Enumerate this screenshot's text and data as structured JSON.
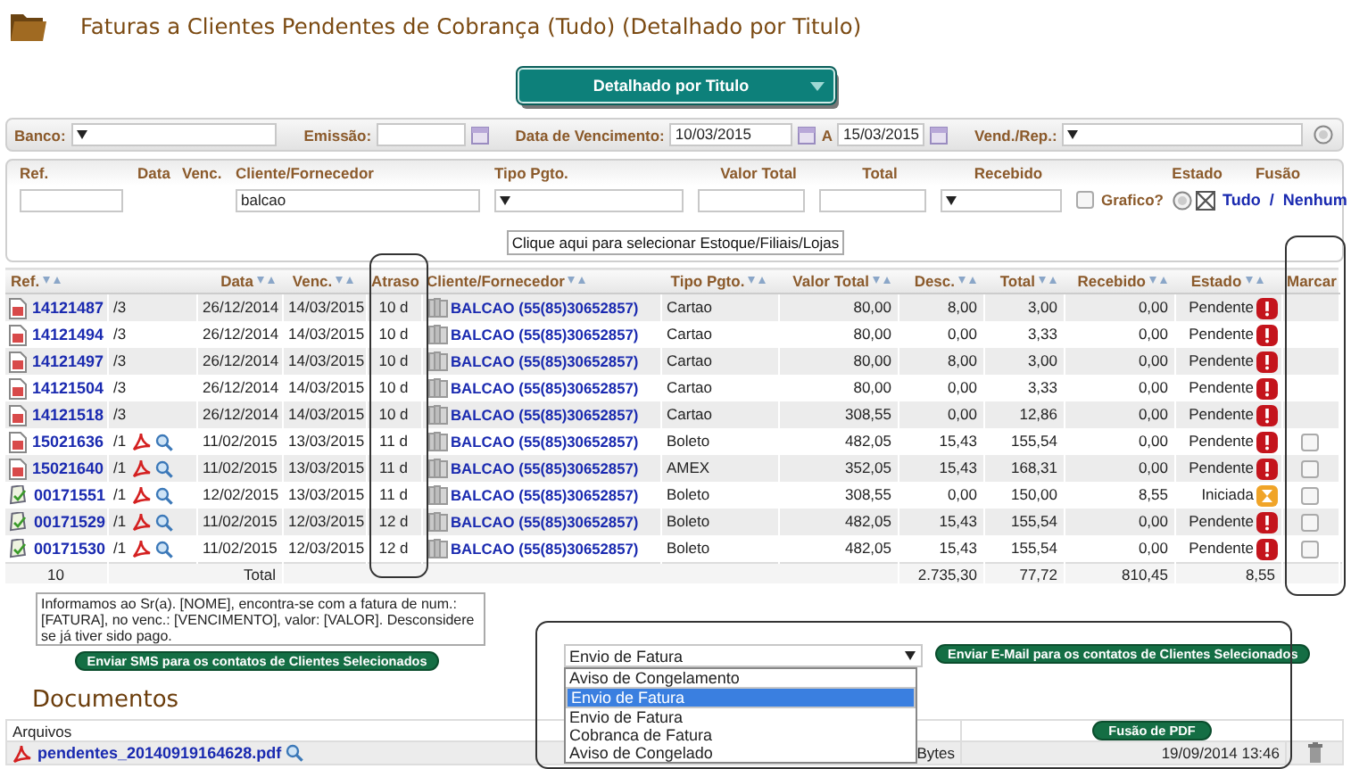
{
  "page": {
    "title": "Faturas a Clientes Pendentes de Cobrança (Tudo) (Detalhado por Titulo)"
  },
  "view_select": {
    "value": "Detalhado por Titulo"
  },
  "filters": {
    "banco_label": "Banco:",
    "emissao_label": "Emissão:",
    "vencimento_label": "Data de Vencimento:",
    "vencimento_from": "10/03/2015",
    "range_label": "A",
    "vencimento_to": "15/03/2015",
    "vendedor_label": "Vend./Rep.:"
  },
  "search": {
    "labels": [
      "Ref.",
      "Data",
      "Venc.",
      "Cliente/Fornecedor",
      "Tipo Pgto.",
      "Valor Total",
      "Total",
      "Recebido",
      "Estado",
      "Fusão"
    ],
    "cliente_value": "balcao",
    "grafico_label": "Grafico?",
    "grafico_checked": false,
    "all_link": "Tudo",
    "separator": "/",
    "none_link": "Nenhum",
    "stores_button": "Clique aqui para selecionar Estoque/Filiais/Lojas"
  },
  "table": {
    "columns": [
      {
        "label": "Ref.",
        "sortable": true
      },
      {
        "label": "Data",
        "sortable": true
      },
      {
        "label": "Venc.",
        "sortable": true
      },
      {
        "label": "Atraso",
        "sortable": false
      },
      {
        "label": "Cliente/Fornecedor",
        "sortable": true
      },
      {
        "label": "Tipo Pgto.",
        "sortable": true
      },
      {
        "label": "Valor Total",
        "sortable": true
      },
      {
        "label": "Desc.",
        "sortable": true
      },
      {
        "label": "Total",
        "sortable": true
      },
      {
        "label": "Recebido",
        "sortable": true
      },
      {
        "label": "Estado",
        "sortable": true
      },
      {
        "label": "Marcar",
        "sortable": false
      }
    ],
    "rows": [
      {
        "kind": "document",
        "ref": "14121487",
        "parcel": "/3",
        "attachments": false,
        "data": "26/12/2014",
        "venc": "14/03/2015",
        "atraso": "10 d",
        "cliente": "BALCAO (55(85)30652857)",
        "tipo": "Cartao",
        "valor_total": "80,00",
        "desc": "8,00",
        "total": "3,00",
        "recebido": "0,00",
        "estado": {
          "label": "Pendente",
          "kind": "pending"
        },
        "markable": false
      },
      {
        "kind": "document",
        "ref": "14121494",
        "parcel": "/3",
        "attachments": false,
        "data": "26/12/2014",
        "venc": "14/03/2015",
        "atraso": "10 d",
        "cliente": "BALCAO (55(85)30652857)",
        "tipo": "Cartao",
        "valor_total": "80,00",
        "desc": "0,00",
        "total": "3,33",
        "recebido": "0,00",
        "estado": {
          "label": "Pendente",
          "kind": "pending"
        },
        "markable": false
      },
      {
        "kind": "document",
        "ref": "14121497",
        "parcel": "/3",
        "attachments": false,
        "data": "26/12/2014",
        "venc": "14/03/2015",
        "atraso": "10 d",
        "cliente": "BALCAO (55(85)30652857)",
        "tipo": "Cartao",
        "valor_total": "80,00",
        "desc": "8,00",
        "total": "3,00",
        "recebido": "0,00",
        "estado": {
          "label": "Pendente",
          "kind": "pending"
        },
        "markable": false
      },
      {
        "kind": "document",
        "ref": "14121504",
        "parcel": "/3",
        "attachments": false,
        "data": "26/12/2014",
        "venc": "14/03/2015",
        "atraso": "10 d",
        "cliente": "BALCAO (55(85)30652857)",
        "tipo": "Cartao",
        "valor_total": "80,00",
        "desc": "0,00",
        "total": "3,33",
        "recebido": "0,00",
        "estado": {
          "label": "Pendente",
          "kind": "pending"
        },
        "markable": false
      },
      {
        "kind": "document",
        "ref": "14121518",
        "parcel": "/3",
        "attachments": false,
        "data": "26/12/2014",
        "venc": "14/03/2015",
        "atraso": "10 d",
        "cliente": "BALCAO (55(85)30652857)",
        "tipo": "Cartao",
        "valor_total": "308,55",
        "desc": "0,00",
        "total": "12,86",
        "recebido": "0,00",
        "estado": {
          "label": "Pendente",
          "kind": "pending"
        },
        "markable": false
      },
      {
        "kind": "document",
        "ref": "15021636",
        "parcel": "/1",
        "attachments": true,
        "data": "11/02/2015",
        "venc": "13/03/2015",
        "atraso": "11 d",
        "cliente": "BALCAO (55(85)30652857)",
        "tipo": "Boleto",
        "valor_total": "482,05",
        "desc": "15,43",
        "total": "155,54",
        "recebido": "0,00",
        "estado": {
          "label": "Pendente",
          "kind": "pending"
        },
        "markable": true,
        "checked": false
      },
      {
        "kind": "document",
        "ref": "15021640",
        "parcel": "/1",
        "attachments": true,
        "data": "11/02/2015",
        "venc": "13/03/2015",
        "atraso": "11 d",
        "cliente": "BALCAO (55(85)30652857)",
        "tipo": "AMEX",
        "valor_total": "352,05",
        "desc": "15,43",
        "total": "168,31",
        "recebido": "0,00",
        "estado": {
          "label": "Pendente",
          "kind": "pending"
        },
        "markable": true,
        "checked": false
      },
      {
        "kind": "signed",
        "ref": "00171551",
        "parcel": "/1",
        "attachments": true,
        "data": "12/02/2015",
        "venc": "13/03/2015",
        "atraso": "11 d",
        "cliente": "BALCAO (55(85)30652857)",
        "tipo": "Boleto",
        "valor_total": "308,55",
        "desc": "0,00",
        "total": "150,00",
        "recebido": "8,55",
        "estado": {
          "label": "Iniciada",
          "kind": "started"
        },
        "markable": true,
        "checked": false
      },
      {
        "kind": "signed",
        "ref": "00171529",
        "parcel": "/1",
        "attachments": true,
        "data": "11/02/2015",
        "venc": "12/03/2015",
        "atraso": "12 d",
        "cliente": "BALCAO (55(85)30652857)",
        "tipo": "Boleto",
        "valor_total": "482,05",
        "desc": "15,43",
        "total": "155,54",
        "recebido": "0,00",
        "estado": {
          "label": "Pendente",
          "kind": "pending"
        },
        "markable": true,
        "checked": false
      },
      {
        "kind": "signed",
        "ref": "00171530",
        "parcel": "/1",
        "attachments": true,
        "data": "11/02/2015",
        "venc": "12/03/2015",
        "atraso": "12 d",
        "cliente": "BALCAO (55(85)30652857)",
        "tipo": "Boleto",
        "valor_total": "482,05",
        "desc": "15,43",
        "total": "155,54",
        "recebido": "0,00",
        "estado": {
          "label": "Pendente",
          "kind": "pending"
        },
        "markable": true,
        "checked": false
      }
    ],
    "footer": {
      "count": "10",
      "label": "Total",
      "valor_total": "2.735,30",
      "desc": "77,72",
      "total": "810,45",
      "recebido": "8,55"
    }
  },
  "sms": {
    "message": "Informamos ao Sr(a). [NOME], encontra-se com a fatura de num.: [FATURA], no venc.: [VENCIMENTO], valor: [VALOR]. Desconsidere se já tiver sido pago.",
    "button": "Enviar SMS para os contatos de Clientes Selecionados"
  },
  "email": {
    "template_value": "Envio de Fatura",
    "options": [
      {
        "label": "Aviso de Congelamento",
        "selected": false
      },
      {
        "label": "Envio de Fatura",
        "selected": true
      },
      {
        "label": "Envio de Fatura",
        "selected": false
      },
      {
        "label": "Cobranca de Fatura",
        "selected": false
      },
      {
        "label": "Aviso de Congelado",
        "selected": false
      }
    ],
    "button": "Enviar E-Mail para os contatos de Clientes Selecionados"
  },
  "documents": {
    "title": "Documentos",
    "header": "Arquivos",
    "merge_button": "Fusão de PDF",
    "files": [
      {
        "name": "pendentes_20140919164628.pdf",
        "size": "Bytes",
        "date": "19/09/2014 13:46"
      }
    ]
  }
}
